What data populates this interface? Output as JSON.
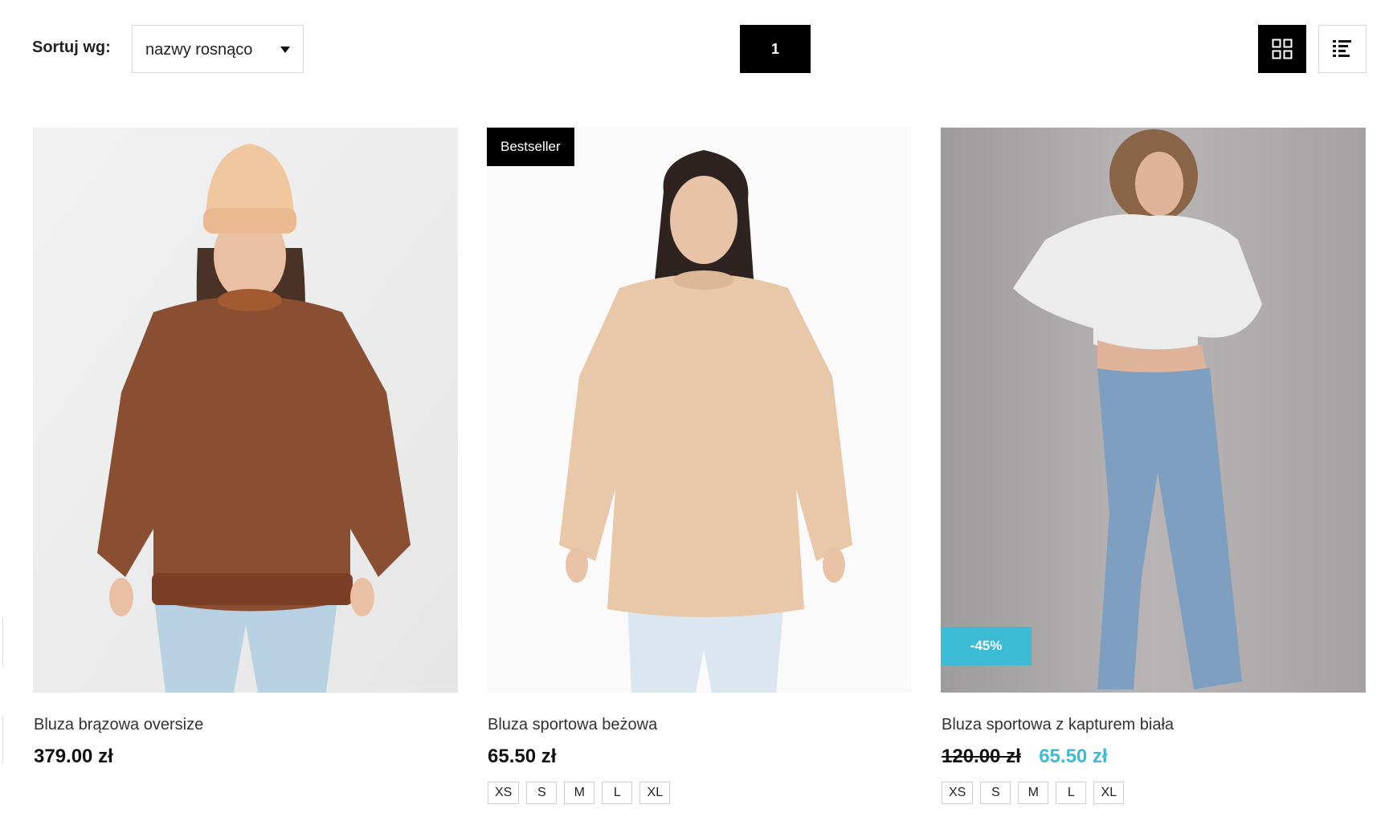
{
  "toolbar": {
    "sort_label": "Sortuj wg:",
    "sort_value": "nazwy rosnąco",
    "current_page": "1",
    "view_grid_icon": "grid-icon",
    "view_list_icon": "list-icon"
  },
  "colors": {
    "accent": "#3bbcd4",
    "primary": "#000000"
  },
  "products": [
    {
      "name": "Bluza brązowa oversize",
      "price": "379.00 zł",
      "image_icon": "person-brown-sweatshirt-image"
    },
    {
      "badge": "Bestseller",
      "name": "Bluza sportowa beżowa",
      "price": "65.50 zł",
      "sizes": [
        "XS",
        "S",
        "M",
        "L",
        "XL"
      ],
      "image_icon": "person-beige-sweatshirt-image"
    },
    {
      "discount_badge": "-45%",
      "name": "Bluza sportowa z kapturem biała",
      "old_price": "120.00 zł",
      "sale_price": "65.50 zł",
      "sizes": [
        "XS",
        "S",
        "M",
        "L",
        "XL"
      ],
      "image_icon": "person-white-hoodie-image"
    }
  ]
}
